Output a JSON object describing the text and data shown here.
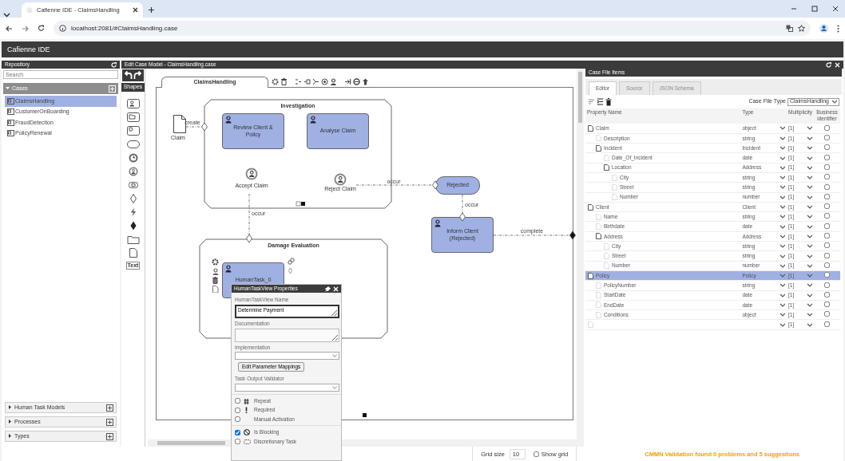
{
  "browser": {
    "tab_title": "Cafienne IDE - ClaimsHandling",
    "url": "localhost:2081/#ClaimsHandling.case"
  },
  "app_title": "Cafienne IDE",
  "repository": {
    "title": "Repository",
    "search_placeholder": "Search",
    "sections": [
      {
        "label": "Cases",
        "expanded": true,
        "items": [
          {
            "label": "ClaimsHandling",
            "selected": true
          },
          {
            "label": "CustomerOnBoarding",
            "selected": false
          },
          {
            "label": "FraudDetection",
            "selected": false
          },
          {
            "label": "PolicyRenewal",
            "selected": false
          }
        ]
      },
      {
        "label": "Human Task Models",
        "expanded": false
      },
      {
        "label": "Processes",
        "expanded": false
      },
      {
        "label": "Types",
        "expanded": false
      }
    ]
  },
  "editor": {
    "title": "Edit Case Model - ClaimsHandling.case",
    "shapes_label": "Shapes",
    "text_tool": "Text",
    "case_tab": "ClaimsHandling",
    "nodes": [
      {
        "kind": "case_file_item",
        "label": "Claim"
      },
      {
        "kind": "stage",
        "label": "Investigation"
      },
      {
        "kind": "human_task",
        "label": "Review Client & Policy"
      },
      {
        "kind": "human_task",
        "label": "Analyse Claim"
      },
      {
        "kind": "user_event",
        "label": "Accept Claim"
      },
      {
        "kind": "user_event",
        "label": "Reject Claim"
      },
      {
        "kind": "milestone",
        "label": "Rejected"
      },
      {
        "kind": "human_task",
        "label": "Inform Client (Rejected)"
      },
      {
        "kind": "stage",
        "label": "Damage Evaluation"
      },
      {
        "kind": "human_task",
        "label": "HumanTask_0"
      }
    ],
    "connectors": [
      {
        "label": "create",
        "kind": "entry"
      },
      {
        "label": "occur",
        "kind": "entry"
      },
      {
        "label": "occur",
        "kind": "entry"
      },
      {
        "label": "occur",
        "kind": "entry"
      },
      {
        "label": "complete",
        "kind": "exit"
      }
    ]
  },
  "task_properties": {
    "title": "HumanTaskView Properties",
    "fields": [
      {
        "kind": "textarea",
        "label": "HumanTaskView Name",
        "value": "Determine Payment"
      },
      {
        "kind": "textarea",
        "label": "Documentation"
      },
      {
        "kind": "select",
        "label": "Implementation"
      },
      {
        "kind": "button",
        "label": "Edit Parameter Mappings"
      },
      {
        "kind": "select",
        "label": "Task Output Validator"
      }
    ],
    "options": [
      {
        "kind": "repeat",
        "label": "Repeat",
        "checked": false
      },
      {
        "kind": "required",
        "label": "Required",
        "checked": false
      },
      {
        "kind": "manual",
        "label": "Manual Activation",
        "checked": false
      },
      {
        "kind": "blocking",
        "label": "Is Blocking",
        "checked": true
      },
      {
        "kind": "discretionary",
        "label": "Discretionary Task",
        "checked": false
      }
    ]
  },
  "case_file": {
    "title": "Case File Items",
    "tabs": [
      {
        "label": "Editor",
        "selected": true
      },
      {
        "label": "Source",
        "selected": false
      },
      {
        "label": "JSON Schema",
        "selected": false
      }
    ],
    "type_label": "Case File Type",
    "type_value": "ClaimsHandling",
    "columns": [
      "Property Name",
      "Type",
      "Multiplicity",
      "Business identifier"
    ],
    "rows": [
      {
        "name": "Claim",
        "type": "object",
        "multiplicity": "[1]",
        "business_identifier": false,
        "selected": false,
        "children": [
          {
            "name": "Description",
            "type": "string",
            "multiplicity": "[1]",
            "business_identifier": false,
            "selected": false
          },
          {
            "name": "Incident",
            "type": "Incident",
            "multiplicity": "[1]",
            "business_identifier": false,
            "selected": false,
            "children": [
              {
                "name": "Date_Of_Incident",
                "type": "date",
                "multiplicity": "[1]",
                "business_identifier": false,
                "selected": false
              },
              {
                "name": "Location",
                "type": "Address",
                "multiplicity": "[1]",
                "business_identifier": false,
                "selected": false,
                "children": [
                  {
                    "name": "City",
                    "type": "string",
                    "multiplicity": "[1]",
                    "business_identifier": false,
                    "selected": false
                  },
                  {
                    "name": "Street",
                    "type": "string",
                    "multiplicity": "[1]",
                    "business_identifier": false,
                    "selected": false
                  },
                  {
                    "name": "Number",
                    "type": "number",
                    "multiplicity": "[1]",
                    "business_identifier": false,
                    "selected": false
                  }
                ]
              }
            ]
          }
        ]
      },
      {
        "name": "Client",
        "type": "Client",
        "multiplicity": "[1]",
        "business_identifier": false,
        "selected": false,
        "children": [
          {
            "name": "Name",
            "type": "string",
            "multiplicity": "[1]",
            "business_identifier": false,
            "selected": false
          },
          {
            "name": "Birthdate",
            "type": "date",
            "multiplicity": "[1]",
            "business_identifier": false,
            "selected": false
          },
          {
            "name": "Address",
            "type": "Address",
            "multiplicity": "[1]",
            "business_identifier": false,
            "selected": false,
            "children": [
              {
                "name": "City",
                "type": "string",
                "multiplicity": "[1]",
                "business_identifier": false,
                "selected": false
              },
              {
                "name": "Street",
                "type": "string",
                "multiplicity": "[1]",
                "business_identifier": false,
                "selected": false
              },
              {
                "name": "Number",
                "type": "number",
                "multiplicity": "[1]",
                "business_identifier": false,
                "selected": false
              }
            ]
          }
        ]
      },
      {
        "name": "Policy",
        "type": "Policy",
        "multiplicity": "[1]",
        "business_identifier": false,
        "selected": true,
        "children": [
          {
            "name": "PolicyNumber",
            "type": "string",
            "multiplicity": "[1]",
            "business_identifier": false,
            "selected": false
          },
          {
            "name": "StartDate",
            "type": "date",
            "multiplicity": "[1]",
            "business_identifier": false,
            "selected": false
          },
          {
            "name": "EndDate",
            "type": "date",
            "multiplicity": "[1]",
            "business_identifier": false,
            "selected": false
          },
          {
            "name": "Conditions",
            "type": "object",
            "multiplicity": "[1]",
            "business_identifier": false,
            "selected": false
          }
        ]
      },
      {
        "multiplicity": "[1]",
        "business_identifier": false,
        "selected": false
      }
    ]
  },
  "status_bar": {
    "grid_size_label": "Grid size",
    "grid_size": "10",
    "show_grid": {
      "label": "Show grid",
      "checked": false
    },
    "validation": "CMMN Validation found 0 problems and 5 suggestions"
  }
}
